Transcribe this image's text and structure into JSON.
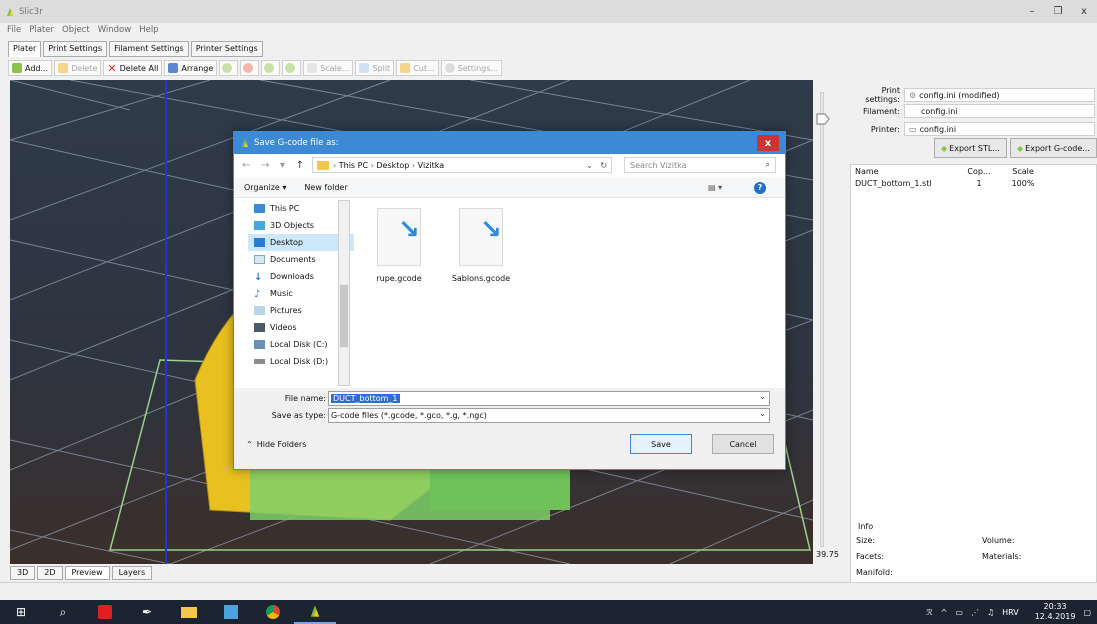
{
  "window": {
    "title": "Slic3r",
    "controls": [
      "–",
      "❐",
      "x"
    ]
  },
  "menu": [
    "File",
    "Plater",
    "Object",
    "Window",
    "Help"
  ],
  "tabs": [
    "Plater",
    "Print Settings",
    "Filament Settings",
    "Printer Settings"
  ],
  "toolbar": {
    "add": "Add...",
    "delete": "Delete",
    "delete_all": "Delete All",
    "arrange": "Arrange",
    "scale": "Scale...",
    "split": "Split",
    "cut": "Cut...",
    "settings": "Settings..."
  },
  "layer_slider": {
    "value": "39.75"
  },
  "view_tabs": [
    "3D",
    "2D",
    "Preview",
    "Layers"
  ],
  "right_panel": {
    "print_settings_label": "Print settings:",
    "print_settings_value": "config.ini (modified)",
    "filament_label": "Filament:",
    "filament_value": "config.ini",
    "printer_label": "Printer:",
    "printer_value": "config.ini",
    "export_stl": "Export STL...",
    "export_gcode": "Export G-code...",
    "columns": {
      "name": "Name",
      "copies": "Cop...",
      "scale": "Scale"
    },
    "objects": [
      {
        "name": "DUCT_bottom_1.stl",
        "copies": "1",
        "scale": "100%"
      }
    ],
    "info": {
      "title": "Info",
      "size": "Size:",
      "volume": "Volume:",
      "facets": "Facets:",
      "materials": "Materials:",
      "manifold": "Manifold:"
    }
  },
  "dialog": {
    "title": "Save G-code file as:",
    "close": "x",
    "path": [
      "This PC",
      "Desktop",
      "Vizitka"
    ],
    "search_placeholder": "Search Vizitka",
    "organize": "Organize ▾",
    "new_folder": "New folder",
    "nav_items": [
      {
        "label": "This PC",
        "icon": "computer-icon"
      },
      {
        "label": "3D Objects",
        "icon": "cube-icon"
      },
      {
        "label": "Desktop",
        "icon": "desktop-icon"
      },
      {
        "label": "Documents",
        "icon": "document-icon"
      },
      {
        "label": "Downloads",
        "icon": "download-icon"
      },
      {
        "label": "Music",
        "icon": "music-icon"
      },
      {
        "label": "Pictures",
        "icon": "pictures-icon"
      },
      {
        "label": "Videos",
        "icon": "video-icon"
      },
      {
        "label": "Local Disk (C:)",
        "icon": "drive-icon"
      },
      {
        "label": "Local Disk (D:)",
        "icon": "drive-icon"
      }
    ],
    "files": [
      "rupe.gcode",
      "Sablons.gcode"
    ],
    "file_name_label": "File name:",
    "file_name_value": "DUCT_bottom_1",
    "save_as_type_label": "Save as type:",
    "save_as_type_value": "G-code files (*.gcode, *.gco, *.g, *.ngc)",
    "hide_folders": "Hide Folders",
    "save": "Save",
    "cancel": "Cancel"
  },
  "taskbar": {
    "language": "HRV",
    "time": "20:33",
    "date": "12.4.2019"
  },
  "colors": {
    "accent": "#3c8ad6",
    "dialog_close": "#cc3333",
    "model_yellow": "#e8c020",
    "model_green": "#7fcf6a"
  }
}
